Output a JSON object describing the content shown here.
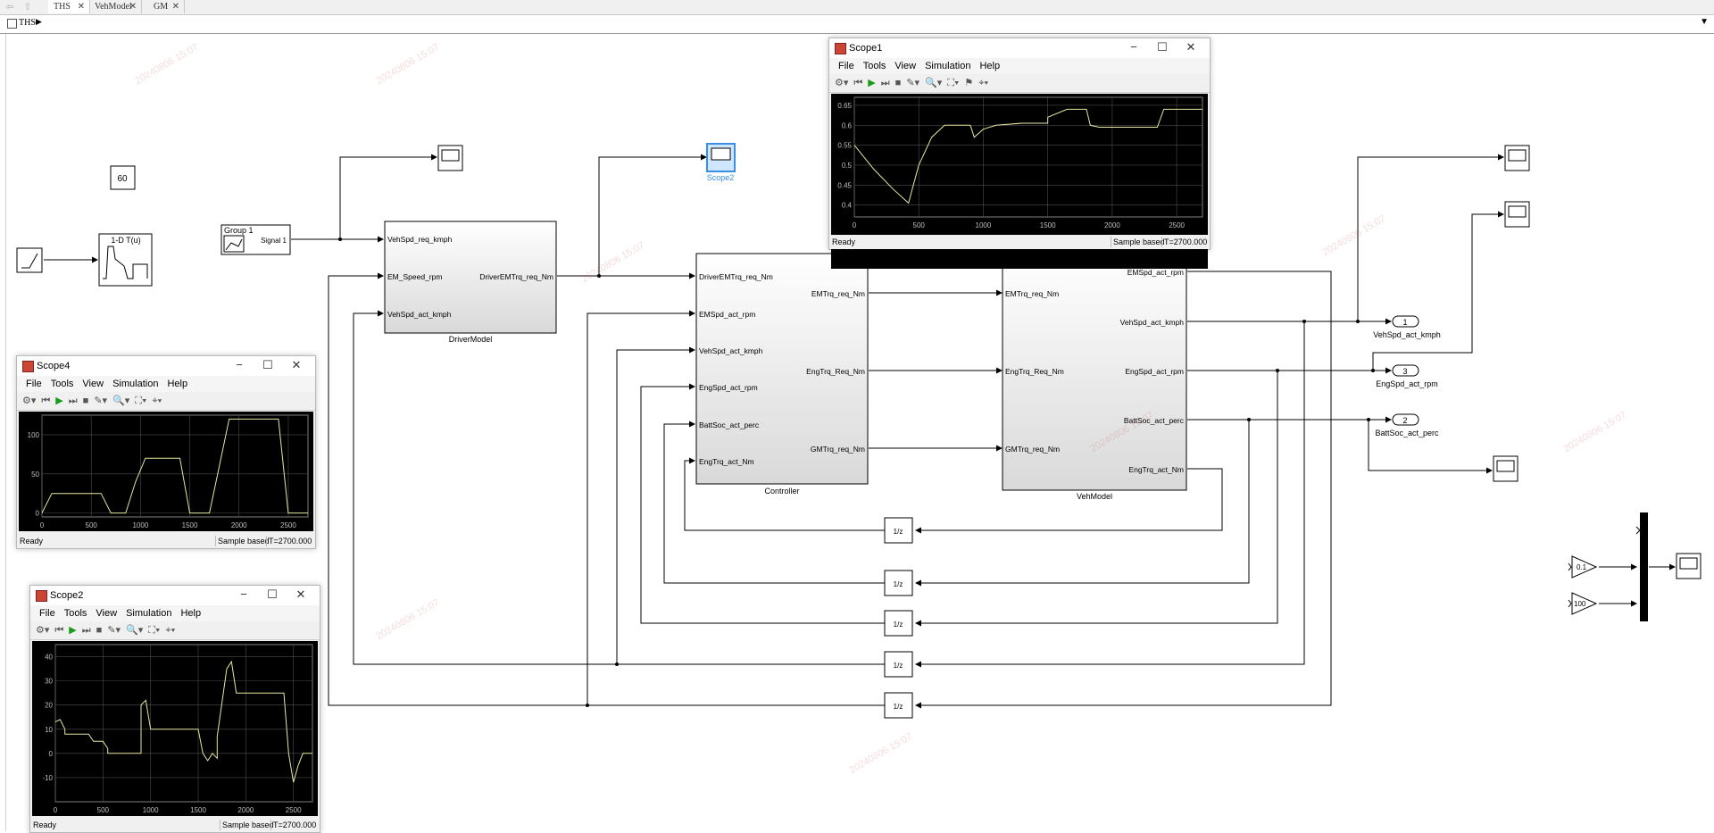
{
  "tabs": [
    {
      "label": "THS",
      "active": true
    },
    {
      "label": "VehModel",
      "active": false
    },
    {
      "label": "GM",
      "active": false
    }
  ],
  "breadcrumb": {
    "label": "THS"
  },
  "blocks": {
    "constant_value": "60",
    "lookup_label": "1-D T(u)",
    "signal_builder_group": "Group 1",
    "signal_builder_port": "Signal 1",
    "scope2_label": "Scope2",
    "unit_delay": "1/z",
    "gain1": "0.1",
    "gain2": "100"
  },
  "driver_model": {
    "name": "DriverModel",
    "inputs": [
      "VehSpd_req_kmph",
      "EM_Speed_rpm",
      "VehSpd_act_kmph"
    ],
    "outputs": [
      "DriverEMTrq_req_Nm"
    ]
  },
  "controller": {
    "name": "Controller",
    "inputs": [
      "DriverEMTrq_req_Nm",
      "EMSpd_act_rpm",
      "VehSpd_act_kmph",
      "EngSpd_act_rpm",
      "BattSoc_act_perc",
      "EngTrq_act_Nm"
    ],
    "outputs": [
      "EMTrq_req_Nm",
      "EngTrq_Req_Nm",
      "GMTrq_req_Nm"
    ]
  },
  "veh_model": {
    "name": "VehModel",
    "inputs": [
      "EMTrq_req_Nm",
      "EngTrq_Req_Nm",
      "GMTrq_req_Nm"
    ],
    "outputs": [
      "EMSpd_act_rpm",
      "VehSpd_act_kmph",
      "EngSpd_act_rpm",
      "BattSoc_act_perc",
      "EngTrq_act_Nm"
    ]
  },
  "outports": [
    {
      "num": "1",
      "label": "VehSpd_act_kmph"
    },
    {
      "num": "3",
      "label": "EngSpd_act_rpm"
    },
    {
      "num": "2",
      "label": "BattSoc_act_perc"
    }
  ],
  "scope_menu": [
    "File",
    "Tools",
    "View",
    "Simulation",
    "Help"
  ],
  "scope1": {
    "title": "Scope1",
    "status": "Ready",
    "mode": "Sample based",
    "time": "T=2700.000",
    "line_color": "#e8e8a0",
    "chart_data": {
      "type": "line",
      "xlim": [
        0,
        2700
      ],
      "ylim": [
        0.37,
        0.67
      ],
      "xticks": [
        0,
        500,
        1000,
        1500,
        2000,
        2500
      ],
      "yticks": [
        0.4,
        0.45,
        0.5,
        0.55,
        0.6,
        0.65
      ],
      "x": [
        0,
        150,
        300,
        420,
        500,
        600,
        700,
        900,
        930,
        1000,
        1100,
        1300,
        1500,
        1500,
        1650,
        1800,
        1830,
        1900,
        2200,
        2350,
        2400,
        2700
      ],
      "y": [
        0.55,
        0.49,
        0.44,
        0.405,
        0.5,
        0.57,
        0.6,
        0.6,
        0.57,
        0.59,
        0.6,
        0.605,
        0.605,
        0.62,
        0.64,
        0.64,
        0.6,
        0.595,
        0.595,
        0.595,
        0.64,
        0.64
      ]
    }
  },
  "scope4": {
    "title": "Scope4",
    "status": "Ready",
    "mode": "Sample based",
    "time": "T=2700.000",
    "line_color": "#e8e8a0",
    "chart_data": {
      "type": "line",
      "xlim": [
        0,
        2700
      ],
      "ylim": [
        -5,
        125
      ],
      "xticks": [
        0,
        500,
        1000,
        1500,
        2000,
        2500
      ],
      "yticks": [
        0,
        50,
        100
      ],
      "x": [
        0,
        100,
        600,
        700,
        850,
        950,
        1050,
        1400,
        1500,
        1700,
        1800,
        1900,
        2400,
        2500,
        2700
      ],
      "y": [
        0,
        25,
        25,
        0,
        0,
        40,
        70,
        70,
        0,
        0,
        60,
        120,
        120,
        0,
        0
      ]
    }
  },
  "scope2": {
    "title": "Scope2",
    "status": "Ready",
    "mode": "Sample based",
    "time": "T=2700.000",
    "line_color": "#e8e8a0",
    "chart_data": {
      "type": "line",
      "xlim": [
        0,
        2700
      ],
      "ylim": [
        -20,
        45
      ],
      "xticks": [
        0,
        500,
        1000,
        1500,
        2000,
        2500
      ],
      "yticks": [
        -10,
        0,
        10,
        20,
        30,
        40
      ],
      "x": [
        0,
        50,
        100,
        100,
        350,
        400,
        500,
        550,
        550,
        700,
        900,
        900,
        950,
        1000,
        1000,
        1500,
        1550,
        1600,
        1650,
        1700,
        1700,
        1800,
        1850,
        1900,
        2000,
        2400,
        2450,
        2500,
        2550,
        2600,
        2700
      ],
      "y": [
        13,
        14,
        10,
        8,
        8,
        5,
        5,
        2,
        0,
        0,
        0,
        20,
        22,
        10,
        10,
        10,
        0,
        -3,
        0,
        -2,
        7,
        35,
        38,
        25,
        25,
        25,
        0,
        -12,
        -5,
        0,
        0
      ]
    }
  }
}
